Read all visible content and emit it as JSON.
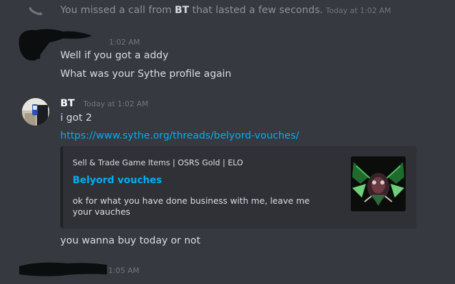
{
  "call_notice": {
    "prefix": "You missed a call from ",
    "caller": "BT",
    "suffix": " that lasted a few seconds.",
    "timestamp": "Today at 1:02 AM"
  },
  "message_group_1": {
    "time_fragment": "1:02 AM",
    "lines": [
      "Well if you got a addy",
      "What was your Sythe profile again"
    ]
  },
  "message_group_2": {
    "author": "BT",
    "timestamp": "Today at 1:02 AM",
    "line_1": "i got 2",
    "link": "https://www.sythe.org/threads/belyord-vouches/",
    "embed": {
      "provider": "Sell & Trade Game Items | OSRS Gold | ELO",
      "title": "Belyord vouches",
      "description": "ok for what you have done business with me, leave me your vauches"
    },
    "line_2": "you wanna buy today or not"
  },
  "message_group_3": {
    "time_fragment": "1:05 AM"
  },
  "colors": {
    "background": "#36393f",
    "link": "#00b0f4",
    "muted": "#72767d",
    "embed_bg": "#2f3136"
  }
}
